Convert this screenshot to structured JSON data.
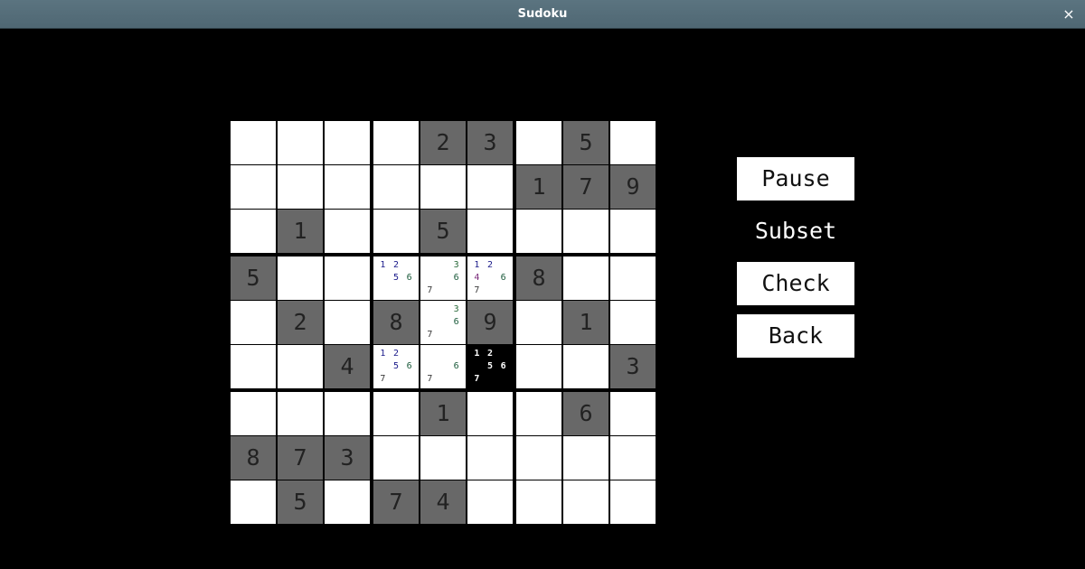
{
  "window": {
    "title": "Sudoku",
    "close_glyph": "×",
    "close_icon": "close-icon"
  },
  "grid": {
    "given": [
      [
        0,
        0,
        0,
        0,
        2,
        3,
        0,
        5,
        0
      ],
      [
        0,
        0,
        0,
        0,
        0,
        0,
        1,
        7,
        9
      ],
      [
        0,
        1,
        0,
        0,
        5,
        0,
        0,
        0,
        0
      ],
      [
        5,
        0,
        0,
        0,
        0,
        0,
        8,
        0,
        0
      ],
      [
        0,
        2,
        0,
        8,
        0,
        9,
        0,
        1,
        0
      ],
      [
        0,
        0,
        4,
        0,
        0,
        0,
        0,
        0,
        3
      ],
      [
        0,
        0,
        0,
        0,
        1,
        0,
        0,
        6,
        0
      ],
      [
        8,
        7,
        3,
        0,
        0,
        0,
        0,
        0,
        0
      ],
      [
        0,
        5,
        0,
        7,
        4,
        0,
        0,
        0,
        0
      ]
    ],
    "notes": [
      {
        "row": 3,
        "col": 3,
        "digits": [
          "1",
          "2",
          "",
          "",
          "5",
          "6",
          "",
          "",
          ""
        ]
      },
      {
        "row": 3,
        "col": 4,
        "digits": [
          "",
          "",
          "3",
          "",
          "",
          "6",
          "7",
          "",
          ""
        ]
      },
      {
        "row": 3,
        "col": 5,
        "digits": [
          "1",
          "2",
          "",
          "4",
          "",
          "6",
          "7",
          "",
          ""
        ]
      },
      {
        "row": 4,
        "col": 4,
        "digits": [
          "",
          "",
          "3",
          "",
          "",
          "6",
          "7",
          "",
          ""
        ]
      },
      {
        "row": 5,
        "col": 3,
        "digits": [
          "1",
          "2",
          "",
          "",
          "5",
          "6",
          "7",
          "",
          ""
        ]
      },
      {
        "row": 5,
        "col": 4,
        "digits": [
          "",
          "",
          "",
          "",
          "",
          "6",
          "7",
          "",
          ""
        ]
      },
      {
        "row": 5,
        "col": 5,
        "digits": [
          "1",
          "2",
          "",
          "",
          "5",
          "6",
          "7",
          "",
          ""
        ]
      }
    ],
    "selected": {
      "row": 5,
      "col": 5
    },
    "note_colors": {
      "1": "#1a1a8a",
      "2": "#1a1a8a",
      "3": "#2a6a3a",
      "4": "#7a2a7a",
      "5": "#1a1a8a",
      "6": "#1a5a3a",
      "7": "#3a3a3a"
    },
    "selected_note_color": "#ffffff"
  },
  "controls": {
    "pause_label": "Pause",
    "mode_label": "Subset",
    "check_label": "Check",
    "back_label": "Back"
  }
}
